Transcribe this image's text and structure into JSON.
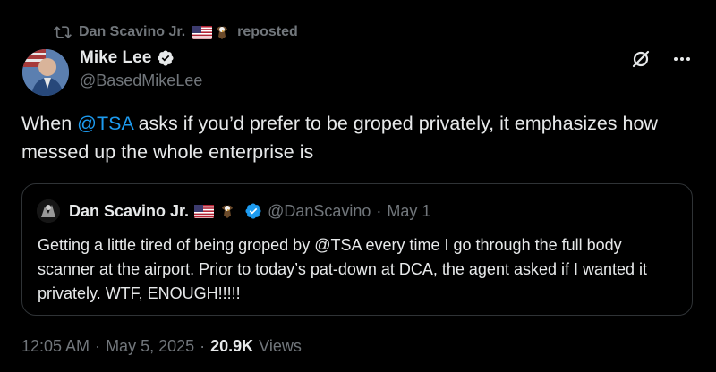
{
  "repost": {
    "reposter_name": "Dan Scavino Jr.",
    "reposted_label": "reposted"
  },
  "author": {
    "name": "Mike Lee",
    "handle": "@BasedMikeLee"
  },
  "tweet": {
    "text_before_mention": "When ",
    "mention": "@TSA",
    "text_after_mention": " asks if you’d prefer to be groped privately, it emphasizes how messed up the whole enterprise is"
  },
  "quoted": {
    "name": "Dan Scavino Jr.",
    "handle": "@DanScavino",
    "separator": "·",
    "date": "May 1",
    "text": "Getting a little tired of being groped by @TSA every time I go through the full body scanner at the airport. Prior to today’s pat-down at DCA, the agent asked if I wanted it privately. WTF, ENOUGH!!!!!"
  },
  "meta": {
    "time": "12:05 AM",
    "sep1": "·",
    "date": "May 5, 2025",
    "sep2": "·",
    "views_count": "20.9K",
    "views_label": "Views"
  },
  "icons": {
    "repost": "repost-icon",
    "verified": "verified-badge-icon",
    "grok": "grok-icon",
    "more": "more-icon",
    "flag": "us-flag-icon",
    "eagle": "eagle-icon"
  },
  "colors": {
    "background": "#000000",
    "text": "#e7e9ea",
    "muted": "#71767b",
    "accent": "#1d9bf0",
    "border": "#2f3336"
  }
}
